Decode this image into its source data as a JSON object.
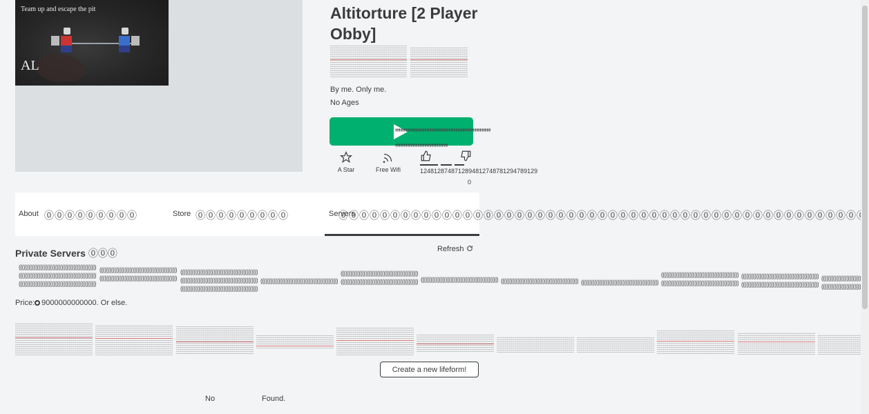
{
  "thumbnail": {
    "caption": "Team up and escape the pit",
    "mark": "AL"
  },
  "game": {
    "title": "Altitorture [2 Player Obby]",
    "creator_line": "By me. Only me.",
    "ages_line": "No Ages",
    "play_icon": "play-icon"
  },
  "glyph_rows": {
    "ones": "ꞋꞋꞋꞋꞋꞋꞋꞋꞋꞋꞋꞋꞋꞋꞋꞋꞋꞋꞋꞋꞋꞋꞋꞋꞋꞋꞋꞋꞋꞋꞋꞋꞋꞋꞋꞋꞋꞋꞋꞋꞋꞋꞋꞋꞋꞋꞋꞋꞋꞋꞋꞋꞋꞋꞋꞋꞋꞋꞋꞋꞋꞋꞋꞋꞋꞋꞋꞋꞋꞋꞋꞋꞋꞋꞋꞋꞋꞋꞋꞋꞋꞋꞋꞋꞋꞋꞋꞋꞋꞋꞋꞋꞋꞋꞋꞋꞋꞋ",
    "ones2": "ꞋꞋꞋꞋꞋꞋꞋꞋꞋꞋꞋꞋꞋꞋꞋꞋꞋꞋꞋꞋꞋꞋꞋꞋꞋꞋꞋꞋꞋꞋꞋꞋꞋꞋꞋꞋꞋꞋꞋꞋꞋꞋꞋꞋꞋꞋꞋꞋꞋꞋꞋꞋꞋꞋ",
    "parens": "((((((((((((((((((((((((((((((((((((((((((((((((((((((((((((((((((((((((((((((((((((((((((((((((((((((((((((((((((("
  },
  "actions": {
    "star_label": "A Star",
    "wifi_label": "Free Wifi",
    "votes_count": "1248128748712894812748781294789129",
    "votes_zero": "0"
  },
  "tabs": {
    "about": "About",
    "store": "Store",
    "servers": "Servers",
    "q_short": "⓪⓪⓪⓪⓪⓪⓪⓪⓪",
    "q_long": "⓪⓪⓪⓪⓪⓪⓪⓪⓪⓪⓪⓪⓪⓪⓪⓪⓪⓪⓪⓪⓪⓪⓪⓪⓪⓪⓪⓪⓪⓪⓪⓪⓪⓪⓪⓪⓪⓪⓪⓪⓪⓪⓪⓪⓪⓪⓪⓪⓪⓪⓪⓪⓪⓪⓪⓪⓪⓪⓪⓪"
  },
  "private_servers": {
    "heading": "Private Servers",
    "heading_q": "⓪⓪⓪",
    "refresh": "Refresh",
    "refresh_icon": "refresh-icon",
    "price_label": "Price:",
    "price_value": "9000000000000. Or else.",
    "create_button": "Create a new lifeform!",
    "empty_word_1": "No",
    "empty_word_2": "Found."
  }
}
